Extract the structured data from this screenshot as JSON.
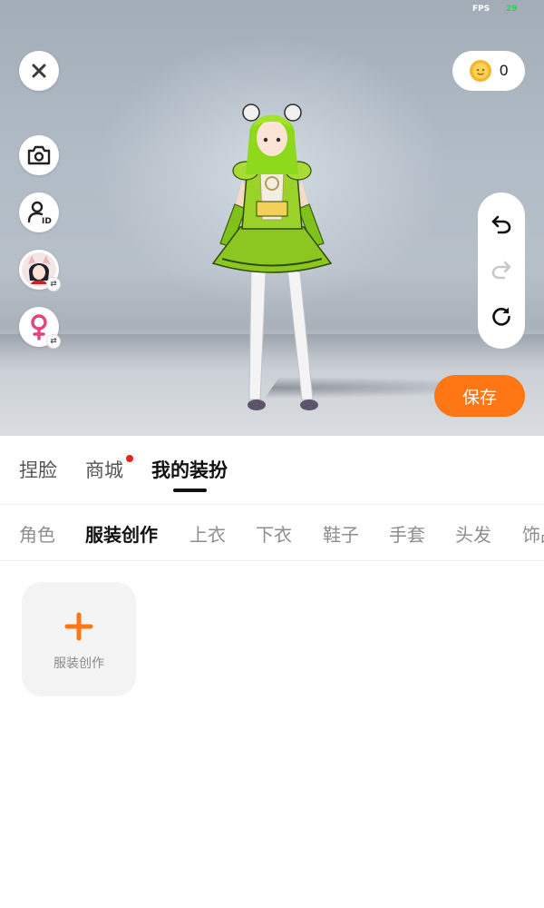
{
  "debug": {
    "fps_label": "FPS",
    "fps_value": "29"
  },
  "viewport": {
    "left_buttons": [
      {
        "name": "close-button",
        "icon": "close-icon"
      },
      {
        "name": "camera-button",
        "icon": "camera-icon"
      },
      {
        "name": "avatar-id-button",
        "icon": "user-id-icon"
      },
      {
        "name": "character-swap-button",
        "icon": "character-avatar",
        "badge": "⇄"
      },
      {
        "name": "gender-swap-button",
        "icon": "female-icon",
        "badge": "⇄"
      }
    ],
    "coins": {
      "icon": "coin-icon",
      "count": "0"
    },
    "history": {
      "undo_icon": "undo-icon",
      "redo_icon": "redo-icon",
      "reset_icon": "reset-icon",
      "redo_enabled": false
    },
    "save_label": "保存"
  },
  "main_tabs": [
    {
      "label": "捏脸",
      "active": false
    },
    {
      "label": "商城",
      "active": false,
      "has_dot": true
    },
    {
      "label": "我的装扮",
      "active": true
    }
  ],
  "sub_tabs": [
    {
      "label": "角色",
      "active": false
    },
    {
      "label": "服装创作",
      "active": true
    },
    {
      "label": "上衣",
      "active": false
    },
    {
      "label": "下衣",
      "active": false
    },
    {
      "label": "鞋子",
      "active": false
    },
    {
      "label": "手套",
      "active": false
    },
    {
      "label": "头发",
      "active": false
    },
    {
      "label": "饰品",
      "active": false
    }
  ],
  "content": {
    "create_card": {
      "icon": "plus-icon",
      "label": "服装创作"
    }
  },
  "colors": {
    "accent": "#ff7614",
    "notify_dot": "#e8231f",
    "female": "#e0457b",
    "coin": "#f5b62e"
  }
}
